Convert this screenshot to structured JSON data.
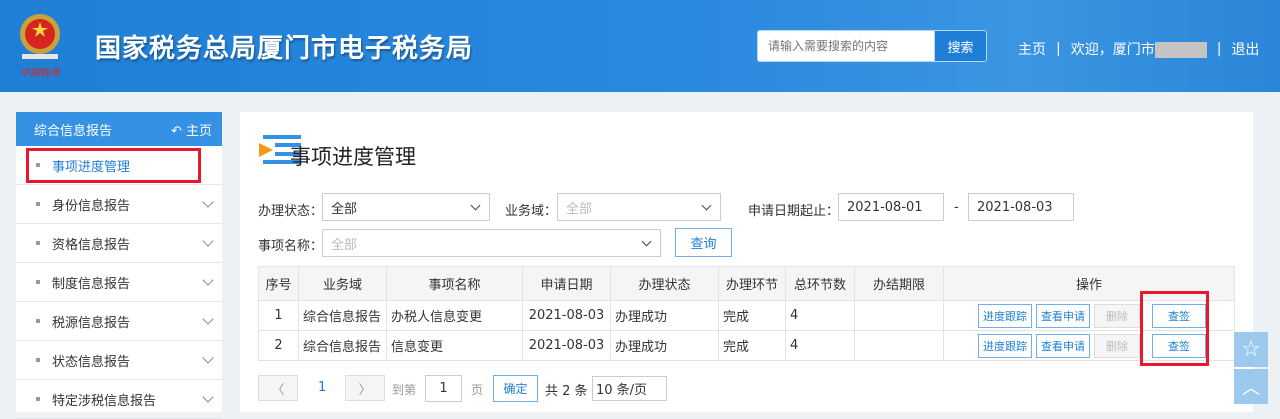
{
  "header": {
    "title": "国家税务总局厦门市电子税务局",
    "logo_text": "中国税务",
    "search_placeholder": "请输入需要搜索的内容",
    "search_button": "搜索",
    "home": "主页",
    "sep": "|",
    "welcome": "欢迎，厦门市",
    "logout": "退出"
  },
  "sidebar": {
    "header": "综合信息报告",
    "home": "主页",
    "items": [
      {
        "label": "事项进度管理",
        "active": true
      },
      {
        "label": "身份信息报告"
      },
      {
        "label": "资格信息报告"
      },
      {
        "label": "制度信息报告"
      },
      {
        "label": "税源信息报告"
      },
      {
        "label": "状态信息报告"
      },
      {
        "label": "特定涉税信息报告"
      }
    ]
  },
  "main": {
    "title": "事项进度管理",
    "filters": {
      "status_label": "办理状态：",
      "status_value": "全部",
      "domain_label": "业务域：",
      "domain_value": "全部",
      "date_label": "申请日期起止：",
      "date_from": "2021-08-01",
      "date_dash": "-",
      "date_to": "2021-08-03",
      "name_label": "事项名称：",
      "name_value": "全部",
      "query_button": "查询"
    },
    "table": {
      "headers": [
        "序号",
        "业务域",
        "事项名称",
        "申请日期",
        "办理状态",
        "办理环节",
        "总环节数",
        "办结期限",
        "操作"
      ],
      "rows": [
        [
          "1",
          "综合信息报告",
          "办税人信息变更",
          "2021-08-03",
          "办理成功",
          "完成",
          "4",
          ""
        ],
        [
          "2",
          "综合信息报告",
          "信息变更",
          "2021-08-03",
          "办理成功",
          "完成",
          "4",
          ""
        ]
      ],
      "actions": [
        "进度跟踪",
        "查看申请",
        "删除",
        "查签"
      ]
    },
    "pagination": {
      "prev": "〈",
      "current": "1",
      "next": "〉",
      "goto_label": "到第",
      "goto_value": "1",
      "page_unit": "页",
      "confirm": "确定",
      "total": "共 2 条",
      "page_size": "10 条/页"
    }
  },
  "colors": {
    "header": "#1f7fd6",
    "accent": "#1f7fd6",
    "highlight": "#e8192c"
  },
  "float": {
    "star": "☆",
    "up": "︿"
  }
}
